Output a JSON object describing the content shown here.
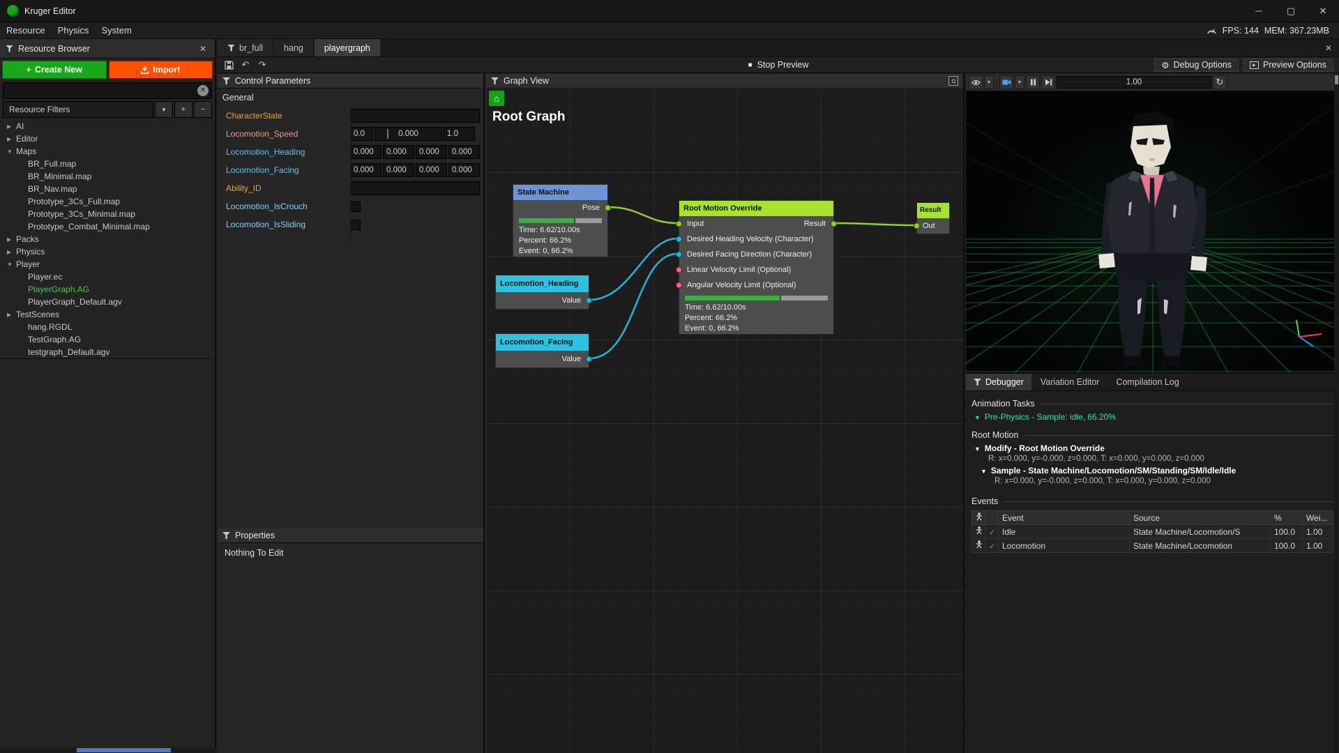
{
  "window": {
    "title": "Kruger Editor",
    "fps_label": "FPS: 144",
    "mem_label": "MEM: 367.23MB"
  },
  "menu": {
    "items": [
      "Resource",
      "Physics",
      "System"
    ]
  },
  "doc_tabs": {
    "items": [
      "br_full",
      "hang",
      "playergraph"
    ],
    "active": "playergraph"
  },
  "toolbar": {
    "stop_preview": "Stop Preview",
    "debug_options": "Debug Options",
    "preview_options": "Preview Options"
  },
  "resource_browser": {
    "title": "Resource Browser",
    "create_new": "Create New",
    "import": "Import",
    "filters_label": "Resource Filters",
    "tree": [
      {
        "a": "▶",
        "label": "AI"
      },
      {
        "a": "▶",
        "label": "Editor"
      },
      {
        "a": "▼",
        "label": "Maps"
      },
      {
        "a": "",
        "label": "BR_Full.map"
      },
      {
        "a": "",
        "label": "BR_Minimal.map"
      },
      {
        "a": "",
        "label": "BR_Nav.map"
      },
      {
        "a": "",
        "label": "Prototype_3Cs_Full.map"
      },
      {
        "a": "",
        "label": "Prototype_3Cs_Minimal.map"
      },
      {
        "a": "",
        "label": "Prototype_Combat_Minimal.map"
      },
      {
        "a": "▶",
        "label": "Packs"
      },
      {
        "a": "▶",
        "label": "Physics"
      },
      {
        "a": "▼",
        "label": "Player"
      },
      {
        "a": "",
        "label": "Player.ec"
      },
      {
        "a": "",
        "label": "PlayerGraph.AG",
        "selected": true
      },
      {
        "a": "",
        "label": "PlayerGraph_Default.agv"
      },
      {
        "a": "▶",
        "label": "TestScenes"
      },
      {
        "a": "",
        "label": "hang.RGDL"
      },
      {
        "a": "",
        "label": "TestGraph.AG"
      },
      {
        "a": "",
        "label": "testgraph_Default.agv"
      }
    ]
  },
  "control_parameters": {
    "title": "Control Parameters",
    "section": "General",
    "rows": [
      {
        "label": "CharacterState",
        "value": ""
      },
      {
        "label": "Locomotion_Speed",
        "min": "0.0",
        "value": "0.000",
        "max": "1.0"
      },
      {
        "label": "Locomotion_Heading",
        "values": [
          "0.000",
          "0.000",
          "0.000",
          "0.000"
        ]
      },
      {
        "label": "Locomotion_Facing",
        "values": [
          "0.000",
          "0.000",
          "0.000",
          "0.000"
        ]
      },
      {
        "label": "Ability_ID",
        "value": ""
      },
      {
        "label": "Locomotion_IsCrouch"
      },
      {
        "label": "Locomotion_IsSliding"
      }
    ]
  },
  "properties": {
    "title": "Properties",
    "empty_text": "Nothing To Edit"
  },
  "graph": {
    "title": "Graph View",
    "root_label": "Root Graph",
    "state_machine": {
      "title": "State Machine",
      "out_port": "Pose",
      "time": "Time: 6.62/10.00s",
      "percent": "Percent: 66.2%",
      "event": "Event: 0, 66.2%",
      "progress_pct": 66.2
    },
    "root_motion_override": {
      "title": "Root Motion Override",
      "in_ports": [
        "Input",
        "Desired Heading Velocity (Character)",
        "Desired Facing Direction (Character)",
        "Linear Velocity Limit (Optional)",
        "Angular Velocity Limit (Optional)"
      ],
      "out_port": "Result",
      "time": "Time: 6.62/10.00s",
      "percent": "Percent: 66.2%",
      "event": "Event: 0, 66.2%",
      "progress_pct": 66.2
    },
    "result_node": {
      "title": "Result",
      "in_port": "Out"
    },
    "locomotion_heading": {
      "title": "Locomotion_Heading",
      "out_port": "Value"
    },
    "locomotion_facing": {
      "title": "Locomotion_Facing",
      "out_port": "Value"
    }
  },
  "viewport": {
    "speed": "1.00"
  },
  "debugger_panel": {
    "tabs": [
      "Debugger",
      "Variation Editor",
      "Compilation Log"
    ],
    "active_tab": "Debugger",
    "animation_tasks_header": "Animation Tasks",
    "task_line": "Pre-Physics - Sample: idle, 66.20%",
    "root_motion_header": "Root Motion",
    "modify_title": "Modify - Root Motion Override",
    "modify_detail": "R: x=0.000, y=-0.000, z=0.000, T: x=0.000, y=0.000, z=0.000",
    "sample_title": "Sample - State Machine/Locomotion/SM/Standing/SM/Idle/Idle",
    "sample_detail": "R: x=0.000, y=-0.000, z=0.000, T: x=0.000, y=0.000, z=0.000",
    "events_header": "Events",
    "events_columns": [
      "Event",
      "Source",
      "%",
      "Wei..."
    ],
    "events_rows": [
      {
        "event": "Idle",
        "source": "State Machine/Locomotion/S",
        "percent": "100.0",
        "weight": "1.00"
      },
      {
        "event": "Locomotion",
        "source": "State Machine/Locomotion",
        "percent": "100.0",
        "weight": "1.00"
      }
    ]
  },
  "colors": {
    "accent_green": "#17a917",
    "accent_orange": "#ff4f00",
    "node_blue": "#6d92d6",
    "node_green": "#a6e22e",
    "node_cyan": "#2bc3e0",
    "wire_green": "#8fd320",
    "wire_cyan": "#1fb6d8",
    "port_pink": "#f06292",
    "param_orange": "#e8a33c",
    "param_salmon": "#ef9a8a",
    "param_cyan": "#52c7f0",
    "selected_item_green": "#3fd23f",
    "debug_task_green": "#2ee59d",
    "grid_green": "#1fd06a"
  }
}
